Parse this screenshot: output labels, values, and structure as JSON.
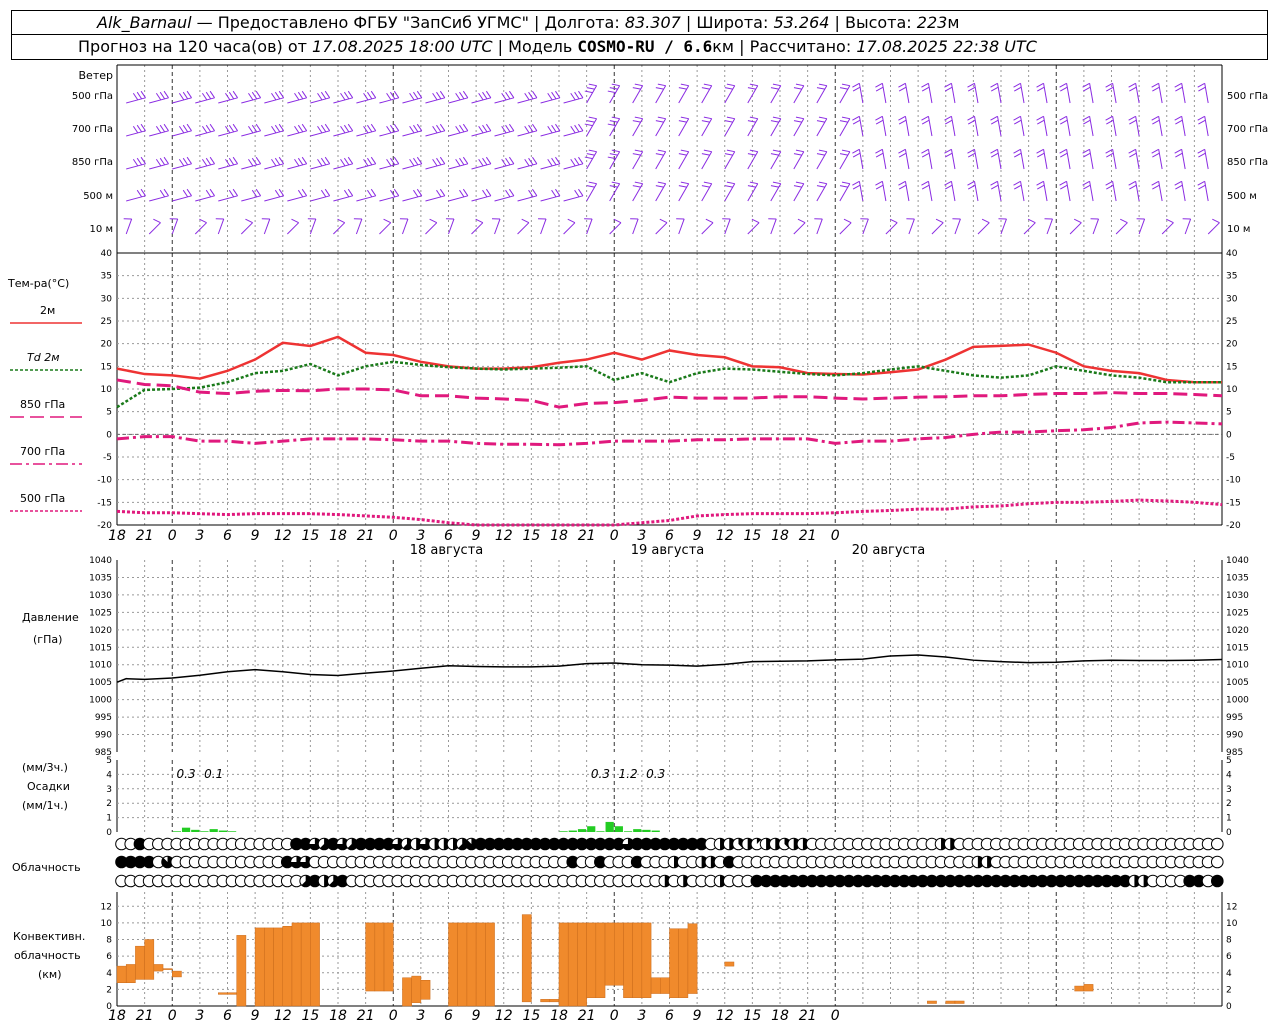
{
  "header": {
    "station": "Alk_Barnaul",
    "provider": " — Предоставлено ФГБУ \"ЗапСиб УГМС\" | Долгота: ",
    "lon": "83.307",
    "lat_label": " | Широта: ",
    "lat": "53.264",
    "alt_label": " | Высота: ",
    "alt": "223",
    "alt_unit": "м",
    "forecast_label": "Прогноз на 120 часа(ов) от ",
    "forecast_from": "17.08.2025 18:00 UTC",
    "model_label": "  | Модель ",
    "model": "COSMO-RU / 6.6",
    "model_unit": "км",
    "calc_label": " | Рассчитано: ",
    "calc": "17.08.2025 22:38 UTC"
  },
  "time_axis": {
    "hour_labels": [
      "18",
      "21",
      "0",
      "3",
      "6",
      "9",
      "12",
      "15",
      "18",
      "21",
      "0",
      "3",
      "6",
      "9",
      "12",
      "15",
      "18",
      "21",
      "0",
      "3",
      "6",
      "9",
      "12",
      "15",
      "18",
      "21",
      "0"
    ],
    "date_labels": [
      {
        "text": "18 августа",
        "hour": 36
      },
      {
        "text": "19 августа",
        "hour": 60
      },
      {
        "text": "20 августа",
        "hour": 84
      }
    ],
    "day_boundary_hours": [
      6,
      30,
      54,
      78,
      102
    ]
  },
  "wind_panel": {
    "title": "Ветер",
    "levels": [
      "500 гПа",
      "700 гПа",
      "850 гПа",
      "500 м",
      "10  м"
    ],
    "color": "#8a2be2"
  },
  "temp_panel": {
    "title": "Тем-ра(°C)",
    "legend": [
      {
        "label": "2м",
        "color": "#ee3333",
        "style": "solid"
      },
      {
        "label": "Td  2м",
        "color": "#1a7a1a",
        "style": "dotted"
      },
      {
        "label": "850 гПа",
        "color": "#e0197d",
        "style": "long-dash"
      },
      {
        "label": "700 гПа",
        "color": "#e0197d",
        "style": "dash-dot"
      },
      {
        "label": "500 гПа",
        "color": "#e0197d",
        "style": "dotted"
      }
    ],
    "yticks": [
      40,
      35,
      30,
      25,
      20,
      15,
      10,
      5,
      0,
      -5,
      -10,
      -15,
      -20
    ]
  },
  "pressure_panel": {
    "title1": "Давление",
    "title2": "(гПа)",
    "yticks": [
      1040,
      1035,
      1030,
      1025,
      1020,
      1015,
      1010,
      1005,
      1000,
      995,
      990,
      985
    ]
  },
  "precip_panel": {
    "title1": "(мм/3ч.)",
    "title2": "Осадки",
    "title3": "(мм/1ч.)",
    "yticks": [
      5,
      4,
      3,
      2,
      1,
      0
    ],
    "sums": [
      {
        "text": "0.3",
        "hour": 7.5
      },
      {
        "text": "0.1",
        "hour": 10.5
      },
      {
        "text": "0.3",
        "hour": 52.5
      },
      {
        "text": "1.2",
        "hour": 55.5
      },
      {
        "text": "0.3",
        "hour": 58.5
      }
    ]
  },
  "cloud_panel": {
    "title": "Облачность"
  },
  "conv_panel": {
    "title1": "Конвективн.",
    "title2": "облачность",
    "title3": "(км)",
    "yticks": [
      12,
      10,
      8,
      6,
      4,
      2,
      0
    ],
    "color": "#f08a2c"
  },
  "chart_data": [
    {
      "type": "line",
      "title": "Тем-ра(°C)",
      "x_unit": "hours from 17.08.2025 18:00 UTC",
      "ylim": [
        -20,
        40
      ],
      "series": [
        {
          "name": "2м",
          "x": [
            0,
            3,
            6,
            9,
            12,
            15,
            18,
            21,
            24,
            27,
            30,
            33,
            36,
            39,
            42,
            45,
            48,
            51,
            54,
            57,
            60,
            63,
            66,
            69,
            72,
            75,
            78,
            81,
            84,
            87,
            90,
            93,
            96,
            99,
            102,
            105,
            108,
            111,
            114,
            117,
            120
          ],
          "values": [
            14.5,
            13.3,
            13.0,
            12.3,
            14.0,
            16.5,
            20.2,
            19.5,
            21.5,
            18.0,
            17.5,
            16.0,
            15.0,
            14.5,
            14.5,
            14.8,
            15.8,
            16.5,
            18.0,
            16.5,
            18.5,
            17.5,
            17.0,
            15.0,
            14.8,
            13.5,
            13.3,
            13.2,
            13.7,
            14.3,
            16.5,
            19.3,
            19.5,
            19.8,
            18.0,
            15.0,
            14.0,
            13.5,
            12.0,
            11.5,
            11.5
          ]
        },
        {
          "name": "Td  2м",
          "x": [
            0,
            3,
            6,
            9,
            12,
            15,
            18,
            21,
            24,
            27,
            30,
            33,
            36,
            39,
            42,
            45,
            48,
            51,
            54,
            57,
            60,
            63,
            66,
            69,
            72,
            75,
            78,
            81,
            84,
            87,
            90,
            93,
            96,
            99,
            102,
            105,
            108,
            111,
            114,
            117,
            120
          ],
          "values": [
            6.0,
            9.8,
            10.0,
            10.3,
            11.5,
            13.5,
            14.0,
            15.5,
            13.0,
            15.0,
            16.0,
            15.3,
            14.8,
            14.5,
            14.3,
            14.5,
            14.7,
            15.0,
            12.0,
            13.5,
            11.5,
            13.5,
            14.5,
            14.3,
            13.8,
            13.3,
            13.0,
            13.5,
            14.3,
            15.0,
            14.0,
            13.0,
            12.5,
            13.0,
            15.0,
            14.0,
            13.0,
            12.5,
            11.5,
            11.5,
            11.5
          ]
        },
        {
          "name": "850 гПа",
          "x": [
            0,
            3,
            6,
            9,
            12,
            15,
            18,
            21,
            24,
            27,
            30,
            33,
            36,
            39,
            42,
            45,
            48,
            51,
            54,
            57,
            60,
            63,
            66,
            69,
            72,
            75,
            78,
            81,
            84,
            87,
            90,
            93,
            96,
            99,
            102,
            105,
            108,
            111,
            114,
            117,
            120
          ],
          "values": [
            12.0,
            11.0,
            10.7,
            9.3,
            9.0,
            9.5,
            9.7,
            9.6,
            10.0,
            10.0,
            9.8,
            8.5,
            8.5,
            8.0,
            7.8,
            7.5,
            6.0,
            6.8,
            7.0,
            7.5,
            8.2,
            8.0,
            8.0,
            8.0,
            8.3,
            8.3,
            8.0,
            7.8,
            8.0,
            8.2,
            8.3,
            8.5,
            8.5,
            8.8,
            9.0,
            9.0,
            9.2,
            9.0,
            9.0,
            8.8,
            8.5
          ]
        },
        {
          "name": "700 гПа",
          "x": [
            0,
            3,
            6,
            9,
            12,
            15,
            18,
            21,
            24,
            27,
            30,
            33,
            36,
            39,
            42,
            45,
            48,
            51,
            54,
            57,
            60,
            63,
            66,
            69,
            72,
            75,
            78,
            81,
            84,
            87,
            90,
            93,
            96,
            99,
            102,
            105,
            108,
            111,
            114,
            117,
            120
          ],
          "values": [
            -1.0,
            -0.5,
            -0.5,
            -1.5,
            -1.5,
            -2.0,
            -1.5,
            -1.0,
            -1.0,
            -1.0,
            -1.2,
            -1.5,
            -1.5,
            -2.0,
            -2.2,
            -2.2,
            -2.3,
            -2.0,
            -1.5,
            -1.5,
            -1.5,
            -1.2,
            -1.2,
            -1.0,
            -1.0,
            -1.0,
            -2.0,
            -1.5,
            -1.5,
            -1.0,
            -0.7,
            0.0,
            0.5,
            0.5,
            0.8,
            1.0,
            1.5,
            2.5,
            2.7,
            2.5,
            2.3
          ]
        },
        {
          "name": "500 гПа",
          "x": [
            0,
            3,
            6,
            9,
            12,
            15,
            18,
            21,
            24,
            27,
            30,
            33,
            36,
            39,
            42,
            45,
            48,
            51,
            54,
            57,
            60,
            63,
            66,
            69,
            72,
            75,
            78,
            81,
            84,
            87,
            90,
            93,
            96,
            99,
            102,
            105,
            108,
            111,
            114,
            117,
            120
          ],
          "values": [
            -17.0,
            -17.3,
            -17.3,
            -17.5,
            -17.7,
            -17.5,
            -17.5,
            -17.5,
            -17.7,
            -18.0,
            -18.3,
            -18.8,
            -19.5,
            -20.0,
            -20.5,
            -21.0,
            -21.0,
            -20.5,
            -20.0,
            -19.5,
            -19.0,
            -18.0,
            -17.7,
            -17.5,
            -17.5,
            -17.5,
            -17.3,
            -17.0,
            -16.8,
            -16.5,
            -16.5,
            -16.0,
            -15.8,
            -15.3,
            -15.0,
            -15.0,
            -14.8,
            -14.5,
            -14.7,
            -15.0,
            -15.5
          ]
        }
      ]
    },
    {
      "type": "line",
      "title": "Давление (гПа)",
      "x_unit": "hours from 17.08.2025 18:00 UTC",
      "ylim": [
        985,
        1040
      ],
      "series": [
        {
          "name": "Давление",
          "x": [
            0,
            1,
            3,
            6,
            9,
            12,
            15,
            18,
            21,
            24,
            27,
            30,
            33,
            36,
            39,
            42,
            45,
            48,
            51,
            54,
            57,
            60,
            63,
            66,
            69,
            72,
            75,
            78,
            81,
            84,
            87,
            90,
            93,
            96,
            99,
            102,
            105,
            108,
            111,
            114,
            117,
            120
          ],
          "values": [
            1005.0,
            1006.0,
            1005.8,
            1006.2,
            1007.0,
            1008.0,
            1008.6,
            1008.0,
            1007.2,
            1006.9,
            1007.6,
            1008.2,
            1009.0,
            1009.7,
            1009.5,
            1009.4,
            1009.4,
            1009.6,
            1010.3,
            1010.5,
            1010.0,
            1009.9,
            1009.6,
            1010.1,
            1010.9,
            1011.0,
            1011.1,
            1011.4,
            1011.6,
            1012.5,
            1012.8,
            1012.2,
            1011.3,
            1010.9,
            1010.6,
            1010.7,
            1011.1,
            1011.3,
            1011.2,
            1011.2,
            1011.3,
            1011.5
          ]
        }
      ]
    },
    {
      "type": "bar",
      "title": "Осадки (мм/1ч.)",
      "x_unit": "hours from 17.08.2025 18:00 UTC",
      "ylim": [
        0,
        5
      ],
      "x": [
        6,
        7,
        8,
        9,
        10,
        11,
        12,
        48,
        49,
        50,
        51,
        52,
        53,
        54,
        55,
        56,
        57,
        58
      ],
      "values": [
        0.05,
        0.3,
        0.15,
        0.05,
        0.2,
        0.1,
        0.05,
        0.05,
        0.1,
        0.2,
        0.4,
        0.05,
        0.7,
        0.4,
        0.05,
        0.2,
        0.15,
        0.1
      ]
    },
    {
      "type": "table",
      "title": "Облачность",
      "encoding": "cloud fraction per hour in eighths (0 = empty circle, 8 = filled circle)",
      "rows": [
        "00800000000000000008865865888865464445788888888888888886888898880443414434400000000000000440000000000000000000000000000040",
        "88880700000000000086600000000000000000000000000008008000800040044080000000000000000000000000044000000000000000000000000004",
        "00000000000000000000584580000000000000000000000000000000000404000400088888888888888888888888888888888888888888440000880888"
      ]
    },
    {
      "type": "bar",
      "title": "Конвективн. облачность (км)",
      "encoding": "each bar spans base..top (km)",
      "x": [
        0,
        1,
        2,
        3,
        4,
        5,
        6,
        11,
        12,
        13,
        15,
        16,
        17,
        18,
        19,
        20,
        21,
        27,
        28,
        29,
        31,
        32,
        33,
        36,
        37,
        38,
        39,
        40,
        44,
        46,
        47,
        48,
        49,
        50,
        51,
        52,
        53,
        54,
        55,
        56,
        57,
        58,
        59,
        60,
        61,
        62,
        66,
        88,
        90,
        91,
        104,
        105
      ],
      "base": [
        2.8,
        2.8,
        3.2,
        3.2,
        4.2,
        4.5,
        3.5,
        1.4,
        1.4,
        0,
        0,
        0,
        0,
        0,
        0,
        0,
        0,
        1.8,
        1.8,
        1.8,
        0,
        0.4,
        0.8,
        0,
        0,
        0,
        0,
        0,
        0.5,
        0.5,
        0.5,
        0,
        0,
        0,
        1.0,
        1.0,
        2.5,
        2.5,
        1.0,
        1.0,
        1.0,
        1.5,
        1.5,
        1.0,
        1.0,
        1.5,
        4.8,
        0.3,
        0.3,
        0.3,
        1.8,
        1.8
      ],
      "top": [
        4.8,
        5.0,
        7.2,
        8.0,
        5.0,
        4.5,
        4.2,
        1.6,
        1.6,
        8.5,
        9.4,
        9.4,
        9.4,
        9.6,
        10.0,
        10.0,
        10.0,
        10.0,
        10.0,
        10.0,
        3.4,
        3.6,
        3.1,
        10.0,
        10.0,
        10.0,
        10.0,
        10.0,
        11.0,
        0.8,
        0.8,
        10.0,
        10.0,
        10.0,
        10.0,
        10.0,
        10.0,
        10.0,
        10.0,
        10.0,
        10.0,
        3.4,
        3.4,
        9.3,
        9.3,
        9.9,
        5.3,
        0.6,
        0.6,
        0.6,
        2.4,
        2.6
      ]
    }
  ]
}
